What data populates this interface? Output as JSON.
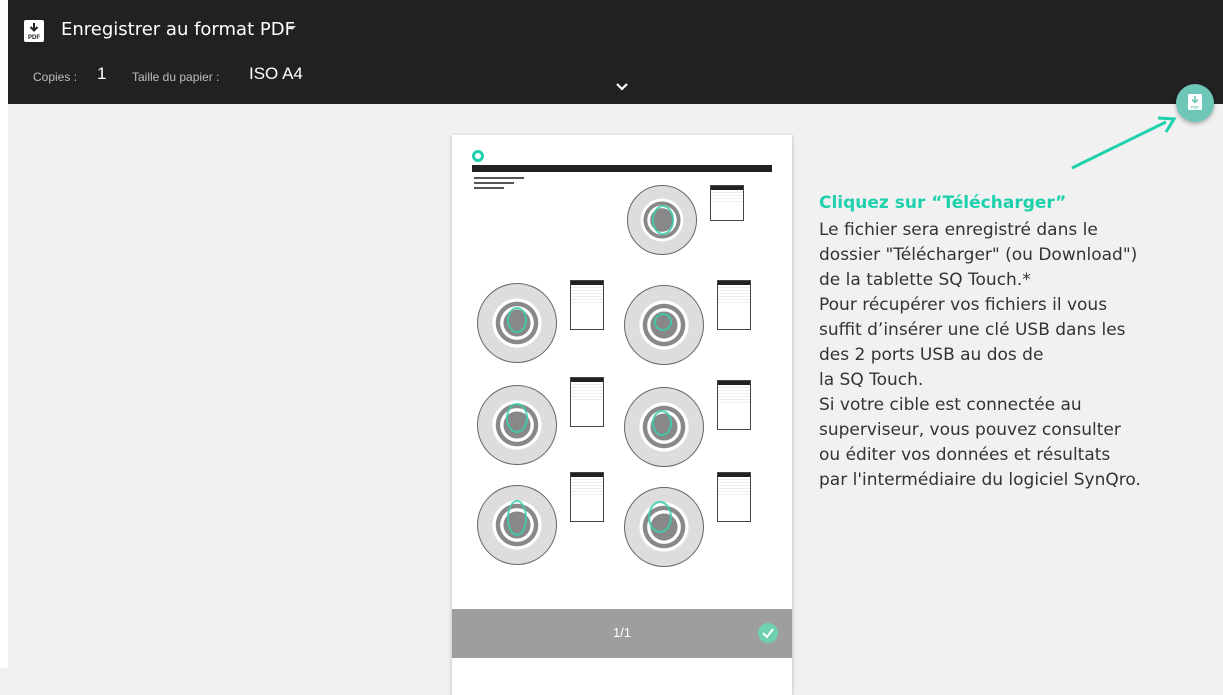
{
  "toolbar": {
    "destination_label": "Enregistrer au format PDF",
    "copies_label": "Copies :",
    "copies_value": "1",
    "paper_label": "Taille du papier :",
    "paper_value": "ISO A4"
  },
  "preview": {
    "page_counter": "1/1"
  },
  "callout": {
    "title": "Cliquez sur “Télécharger”",
    "body": "Le fichier sera enregistré dans le\ndossier \"Télécharger\" (ou Download\")\nde la tablette SQ Touch.*\nPour récupérer vos fichiers il vous\nsuffit d’insérer une clé USB dans les\ndes 2 ports USB au dos de\nla SQ Touch.\nSi votre cible est connectée au\nsuperviseur, vous pouvez consulter\nou éditer vos données et résultats\npar l'intermédiaire du logiciel SynQro."
  },
  "icons": {
    "pdf": "pdf-file-icon",
    "dropdown": "dropdown-arrow-icon",
    "expand": "chevron-down-icon",
    "download": "download-icon",
    "check": "check-icon"
  },
  "colors": {
    "accent": "#1ed1ac",
    "toolbar_bg": "#212121",
    "fab": "#6ec6b8"
  }
}
